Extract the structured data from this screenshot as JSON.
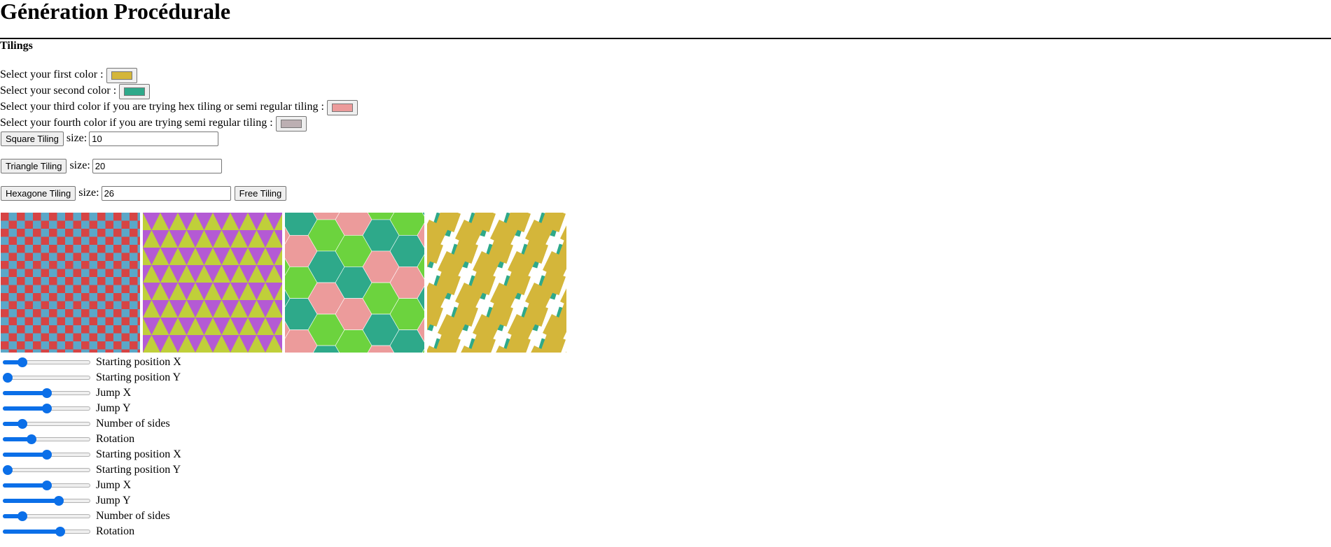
{
  "page": {
    "title": "Génération Procédurale",
    "section_title": "Tilings"
  },
  "colors": {
    "first": {
      "label": "Select your first color :",
      "value": "#d4b63a"
    },
    "second": {
      "label": "Select your second color :",
      "value": "#2ea98a"
    },
    "third": {
      "label": "Select your third color if you are trying hex tiling or semi regular tiling :",
      "value": "#ec9b9b"
    },
    "fourth": {
      "label": "Select your fourth color if you are trying semi regular tiling :",
      "value": "#bcafb2"
    }
  },
  "square": {
    "button": "Square Tiling",
    "size_label": "size:",
    "size_value": "10"
  },
  "triangle": {
    "button": "Triangle Tiling",
    "size_label": "size:",
    "size_value": "20"
  },
  "hexagon": {
    "button": "Hexagone Tiling",
    "size_label": "size:",
    "size_value": "26",
    "free_button": "Free Tiling"
  },
  "canvas_colors": {
    "square_a": "#d64444",
    "square_b": "#5ba7c8",
    "tri_a": "#c0cf3a",
    "tri_b": "#b45ad4",
    "hex_a": "#2ea98a",
    "hex_b": "#6cd33e",
    "hex_c": "#ec9b9b",
    "free_a": "#d4b63a",
    "free_b": "#2ea98a"
  },
  "sliders": [
    {
      "label": "Starting position X",
      "value": 0.19
    },
    {
      "label": "Starting position Y",
      "value": 0.0
    },
    {
      "label": "Jump X",
      "value": 0.5
    },
    {
      "label": "Jump Y",
      "value": 0.5
    },
    {
      "label": "Number of sides",
      "value": 0.19
    },
    {
      "label": "Rotation",
      "value": 0.31
    },
    {
      "label": "Starting position X",
      "value": 0.5
    },
    {
      "label": "Starting position Y",
      "value": 0.0
    },
    {
      "label": "Jump X",
      "value": 0.5
    },
    {
      "label": "Jump Y",
      "value": 0.66
    },
    {
      "label": "Number of sides",
      "value": 0.19
    },
    {
      "label": "Rotation",
      "value": 0.68
    }
  ]
}
